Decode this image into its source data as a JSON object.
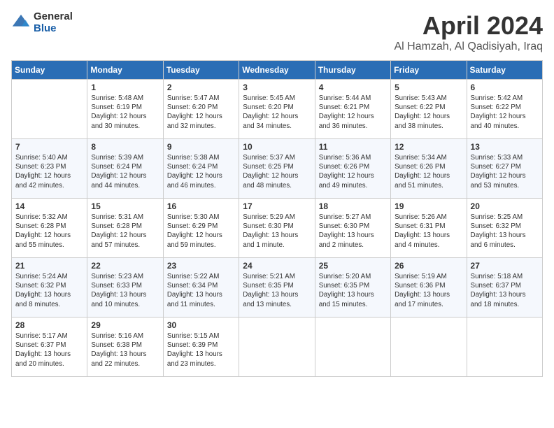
{
  "header": {
    "logo_general": "General",
    "logo_blue": "Blue",
    "month_title": "April 2024",
    "location": "Al Hamzah, Al Qadisiyah, Iraq"
  },
  "days_of_week": [
    "Sunday",
    "Monday",
    "Tuesday",
    "Wednesday",
    "Thursday",
    "Friday",
    "Saturday"
  ],
  "weeks": [
    [
      {
        "day": "",
        "info": ""
      },
      {
        "day": "1",
        "info": "Sunrise: 5:48 AM\nSunset: 6:19 PM\nDaylight: 12 hours\nand 30 minutes."
      },
      {
        "day": "2",
        "info": "Sunrise: 5:47 AM\nSunset: 6:20 PM\nDaylight: 12 hours\nand 32 minutes."
      },
      {
        "day": "3",
        "info": "Sunrise: 5:45 AM\nSunset: 6:20 PM\nDaylight: 12 hours\nand 34 minutes."
      },
      {
        "day": "4",
        "info": "Sunrise: 5:44 AM\nSunset: 6:21 PM\nDaylight: 12 hours\nand 36 minutes."
      },
      {
        "day": "5",
        "info": "Sunrise: 5:43 AM\nSunset: 6:22 PM\nDaylight: 12 hours\nand 38 minutes."
      },
      {
        "day": "6",
        "info": "Sunrise: 5:42 AM\nSunset: 6:22 PM\nDaylight: 12 hours\nand 40 minutes."
      }
    ],
    [
      {
        "day": "7",
        "info": "Sunrise: 5:40 AM\nSunset: 6:23 PM\nDaylight: 12 hours\nand 42 minutes."
      },
      {
        "day": "8",
        "info": "Sunrise: 5:39 AM\nSunset: 6:24 PM\nDaylight: 12 hours\nand 44 minutes."
      },
      {
        "day": "9",
        "info": "Sunrise: 5:38 AM\nSunset: 6:24 PM\nDaylight: 12 hours\nand 46 minutes."
      },
      {
        "day": "10",
        "info": "Sunrise: 5:37 AM\nSunset: 6:25 PM\nDaylight: 12 hours\nand 48 minutes."
      },
      {
        "day": "11",
        "info": "Sunrise: 5:36 AM\nSunset: 6:26 PM\nDaylight: 12 hours\nand 49 minutes."
      },
      {
        "day": "12",
        "info": "Sunrise: 5:34 AM\nSunset: 6:26 PM\nDaylight: 12 hours\nand 51 minutes."
      },
      {
        "day": "13",
        "info": "Sunrise: 5:33 AM\nSunset: 6:27 PM\nDaylight: 12 hours\nand 53 minutes."
      }
    ],
    [
      {
        "day": "14",
        "info": "Sunrise: 5:32 AM\nSunset: 6:28 PM\nDaylight: 12 hours\nand 55 minutes."
      },
      {
        "day": "15",
        "info": "Sunrise: 5:31 AM\nSunset: 6:28 PM\nDaylight: 12 hours\nand 57 minutes."
      },
      {
        "day": "16",
        "info": "Sunrise: 5:30 AM\nSunset: 6:29 PM\nDaylight: 12 hours\nand 59 minutes."
      },
      {
        "day": "17",
        "info": "Sunrise: 5:29 AM\nSunset: 6:30 PM\nDaylight: 13 hours\nand 1 minute."
      },
      {
        "day": "18",
        "info": "Sunrise: 5:27 AM\nSunset: 6:30 PM\nDaylight: 13 hours\nand 2 minutes."
      },
      {
        "day": "19",
        "info": "Sunrise: 5:26 AM\nSunset: 6:31 PM\nDaylight: 13 hours\nand 4 minutes."
      },
      {
        "day": "20",
        "info": "Sunrise: 5:25 AM\nSunset: 6:32 PM\nDaylight: 13 hours\nand 6 minutes."
      }
    ],
    [
      {
        "day": "21",
        "info": "Sunrise: 5:24 AM\nSunset: 6:32 PM\nDaylight: 13 hours\nand 8 minutes."
      },
      {
        "day": "22",
        "info": "Sunrise: 5:23 AM\nSunset: 6:33 PM\nDaylight: 13 hours\nand 10 minutes."
      },
      {
        "day": "23",
        "info": "Sunrise: 5:22 AM\nSunset: 6:34 PM\nDaylight: 13 hours\nand 11 minutes."
      },
      {
        "day": "24",
        "info": "Sunrise: 5:21 AM\nSunset: 6:35 PM\nDaylight: 13 hours\nand 13 minutes."
      },
      {
        "day": "25",
        "info": "Sunrise: 5:20 AM\nSunset: 6:35 PM\nDaylight: 13 hours\nand 15 minutes."
      },
      {
        "day": "26",
        "info": "Sunrise: 5:19 AM\nSunset: 6:36 PM\nDaylight: 13 hours\nand 17 minutes."
      },
      {
        "day": "27",
        "info": "Sunrise: 5:18 AM\nSunset: 6:37 PM\nDaylight: 13 hours\nand 18 minutes."
      }
    ],
    [
      {
        "day": "28",
        "info": "Sunrise: 5:17 AM\nSunset: 6:37 PM\nDaylight: 13 hours\nand 20 minutes."
      },
      {
        "day": "29",
        "info": "Sunrise: 5:16 AM\nSunset: 6:38 PM\nDaylight: 13 hours\nand 22 minutes."
      },
      {
        "day": "30",
        "info": "Sunrise: 5:15 AM\nSunset: 6:39 PM\nDaylight: 13 hours\nand 23 minutes."
      },
      {
        "day": "",
        "info": ""
      },
      {
        "day": "",
        "info": ""
      },
      {
        "day": "",
        "info": ""
      },
      {
        "day": "",
        "info": ""
      }
    ]
  ]
}
